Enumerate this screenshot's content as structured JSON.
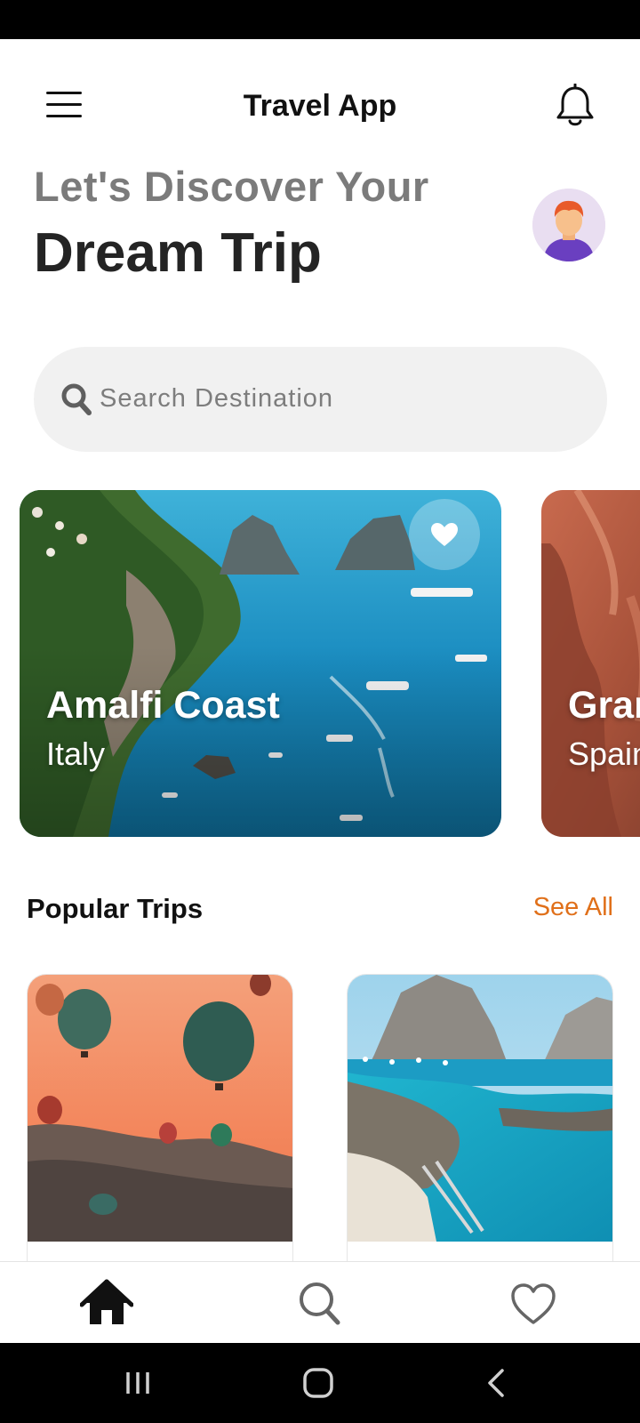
{
  "app": {
    "title": "Travel App"
  },
  "header": {
    "greeting": "Let's Discover Your",
    "headline": "Dream Trip"
  },
  "search": {
    "placeholder": "Search Destination"
  },
  "destinations": [
    {
      "name": "Amalfi Coast",
      "country": "Italy",
      "favorited": true
    },
    {
      "name": "Gran",
      "country": "Spain"
    }
  ],
  "popular": {
    "title": "Popular Trips",
    "see_all": "See All"
  },
  "bottom_nav": [
    "home-icon",
    "search-icon",
    "heart-icon"
  ],
  "colors": {
    "accent": "#e0701a",
    "text_dark": "#242424",
    "text_muted": "#7b7b7b",
    "search_bg": "#f1f1f1"
  }
}
